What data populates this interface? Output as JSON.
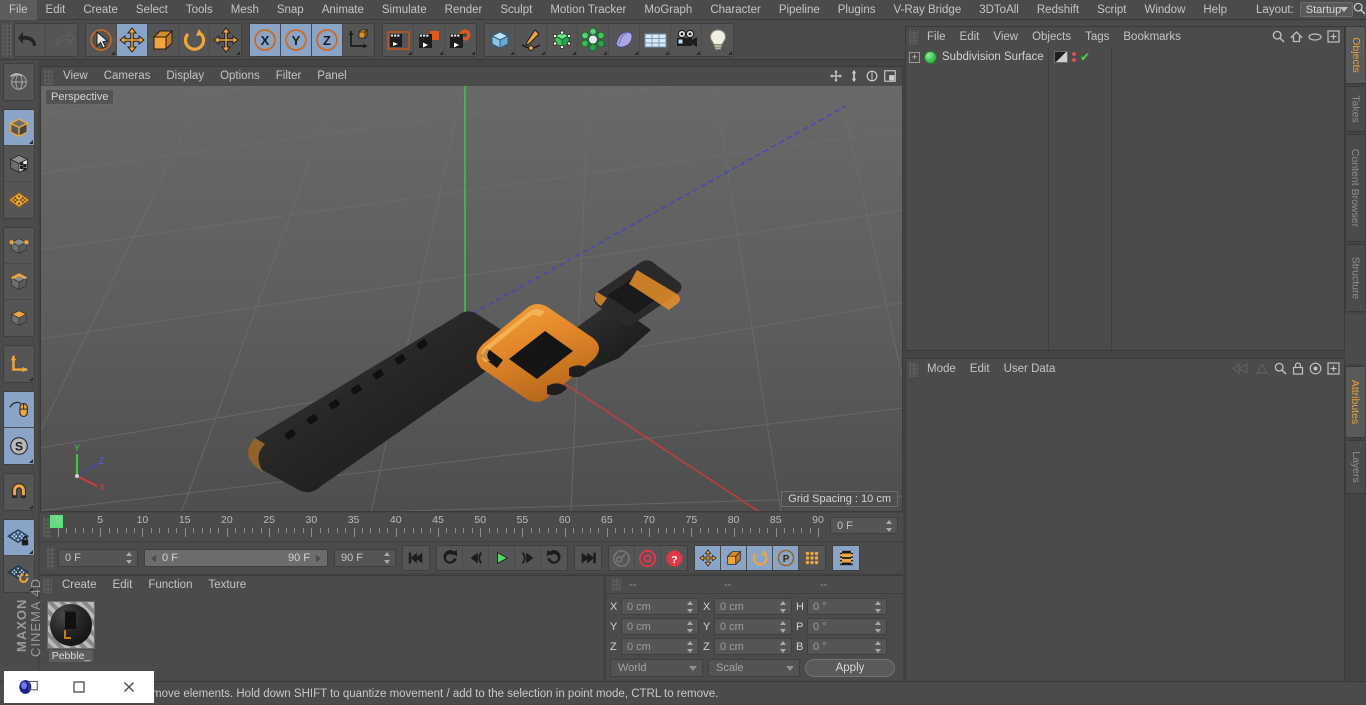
{
  "menubar": {
    "items": [
      "File",
      "Edit",
      "Create",
      "Select",
      "Tools",
      "Mesh",
      "Snap",
      "Animate",
      "Simulate",
      "Render",
      "Sculpt",
      "Motion Tracker",
      "MoGraph",
      "Character",
      "Pipeline",
      "Plugins",
      "V-Ray Bridge",
      "3DToAll",
      "Redshift",
      "Script",
      "Window",
      "Help"
    ],
    "layout_label": "Layout:",
    "layout_value": "Startup",
    "search_icon": "search-icon"
  },
  "toolbar": {
    "groups": [
      {
        "name": "history",
        "buttons": [
          {
            "icon": "undo-icon",
            "label": "Undo",
            "state": "off"
          },
          {
            "icon": "redo-icon",
            "label": "Redo",
            "state": "disabled"
          }
        ]
      },
      {
        "name": "transform",
        "buttons": [
          {
            "icon": "live-selection-icon",
            "label": "Live Selection",
            "state": "off"
          },
          {
            "icon": "move-icon",
            "label": "Move",
            "state": "on"
          },
          {
            "icon": "scale-icon",
            "label": "Scale",
            "state": "off"
          },
          {
            "icon": "rotate-icon",
            "label": "Rotate",
            "state": "off"
          },
          {
            "icon": "move-dup-icon",
            "label": "Move Tool",
            "state": "off"
          }
        ]
      },
      {
        "name": "axis-lock",
        "buttons": [
          {
            "icon": "axis-x-icon",
            "label": "X",
            "state": "on"
          },
          {
            "icon": "axis-y-icon",
            "label": "Y",
            "state": "on"
          },
          {
            "icon": "axis-z-icon",
            "label": "Z",
            "state": "on"
          },
          {
            "icon": "world-object-axis-icon",
            "label": "World/Object",
            "state": "off"
          }
        ]
      },
      {
        "name": "render",
        "buttons": [
          {
            "icon": "render-view-icon",
            "label": "Render View",
            "state": "off"
          },
          {
            "icon": "render-region-icon",
            "label": "Render to Picture Viewer",
            "state": "off"
          },
          {
            "icon": "render-settings-icon",
            "label": "Edit Render Settings",
            "state": "off"
          }
        ]
      },
      {
        "name": "create",
        "buttons": [
          {
            "icon": "cube-primitive-icon",
            "label": "Add Cube Object",
            "state": "off"
          },
          {
            "icon": "spline-pen-icon",
            "label": "Add Spline",
            "state": "off"
          },
          {
            "icon": "generator-icon",
            "label": "Add Generator",
            "state": "off"
          },
          {
            "icon": "deformer-icon",
            "label": "Add Deformer",
            "state": "off"
          },
          {
            "icon": "scene-object-icon",
            "label": "Scene Object",
            "state": "off"
          },
          {
            "icon": "environment-icon",
            "label": "Environment",
            "state": "off"
          },
          {
            "icon": "camera-icon",
            "label": "Add Camera",
            "state": "off"
          },
          {
            "icon": "light-icon",
            "label": "Add Light",
            "state": "off"
          }
        ]
      }
    ]
  },
  "left_palette": {
    "groups": [
      {
        "buttons": [
          {
            "icon": "undo-view-icon",
            "label": "Undo View",
            "state": "off"
          }
        ]
      },
      {
        "buttons": [
          {
            "icon": "model-mode-icon",
            "label": "Model Mode",
            "state": "on"
          },
          {
            "icon": "texture-mode-icon",
            "label": "Texture Mode",
            "state": "off"
          },
          {
            "icon": "workplane-icon",
            "label": "Workplane",
            "state": "off"
          }
        ]
      },
      {
        "buttons": [
          {
            "icon": "points-mode-icon",
            "label": "Points",
            "state": "off"
          },
          {
            "icon": "edges-mode-icon",
            "label": "Edges",
            "state": "off"
          },
          {
            "icon": "polygons-mode-icon",
            "label": "Polygons",
            "state": "off"
          }
        ]
      },
      {
        "buttons": [
          {
            "icon": "axis-modify-icon",
            "label": "Enable Axis Modification",
            "state": "off"
          }
        ]
      },
      {
        "buttons": [
          {
            "icon": "viewport-solo-icon",
            "label": "Viewport Solo",
            "state": "on"
          },
          {
            "icon": "soft-selection-icon",
            "label": "Soft Selection",
            "state": "on"
          }
        ]
      },
      {
        "buttons": [
          {
            "icon": "magnet-icon",
            "label": "Magnet",
            "state": "off"
          }
        ]
      },
      {
        "buttons": [
          {
            "icon": "lock-workplane-icon",
            "label": "Lock Workplane",
            "state": "on"
          },
          {
            "icon": "planar-workplane-icon",
            "label": "Planar Workplane",
            "state": "off"
          }
        ]
      }
    ],
    "brand_top": "MAXON",
    "brand_bottom": "CINEMA 4D"
  },
  "viewport": {
    "menu": [
      "View",
      "Cameras",
      "Display",
      "Options",
      "Filter",
      "Panel"
    ],
    "corner_icons": [
      "pan-icon",
      "dolly-icon",
      "orbit-icon",
      "maximize-icon"
    ],
    "label": "Perspective",
    "grid_spacing": "Grid Spacing : 10 cm",
    "axis_gizmo": {
      "x": "X",
      "y": "Y",
      "z": "Z"
    },
    "scene_object": "Pebble smartwatch"
  },
  "timeline": {
    "ticks": [
      0,
      5,
      10,
      15,
      20,
      25,
      30,
      35,
      40,
      45,
      50,
      55,
      60,
      65,
      70,
      75,
      80,
      85,
      90
    ],
    "current_frame_field": "0 F",
    "playhead_frame": 0
  },
  "playbar": {
    "current_frame": "0 F",
    "range_start": "0 F",
    "range_end": "90 F",
    "max_frame": "90 F",
    "buttons": [
      {
        "icon": "go-to-start-icon",
        "label": "Go to Start",
        "state": "off"
      },
      {
        "icon": "previous-key-icon",
        "label": "Go to Previous Key",
        "state": "off"
      },
      {
        "icon": "previous-frame-icon",
        "label": "Go to Previous Frame",
        "state": "off"
      },
      {
        "icon": "play-icon",
        "label": "Play Forwards",
        "state": "off"
      },
      {
        "icon": "next-frame-icon",
        "label": "Go to Next Frame",
        "state": "off"
      },
      {
        "icon": "next-key-icon",
        "label": "Go to Next Key",
        "state": "off"
      },
      {
        "icon": "go-to-end-icon",
        "label": "Go to End",
        "state": "off"
      }
    ],
    "record_buttons": [
      {
        "icon": "autokey-icon",
        "label": "Autokeying",
        "state": "disabled"
      },
      {
        "icon": "record-icon",
        "label": "Record Active Objects",
        "state": "off"
      },
      {
        "icon": "keyframe-select-icon",
        "label": "Keyframe Selection",
        "state": "off"
      }
    ],
    "param_buttons": [
      {
        "icon": "key-position-icon",
        "label": "Position",
        "state": "on"
      },
      {
        "icon": "key-scale-icon",
        "label": "Scale",
        "state": "on"
      },
      {
        "icon": "key-rotation-icon",
        "label": "Rotation",
        "state": "on"
      },
      {
        "icon": "key-pla-icon",
        "label": "Point Level Animation",
        "state": "on"
      },
      {
        "icon": "key-param-icon",
        "label": "Parameter",
        "state": "off"
      }
    ],
    "dope_button": {
      "icon": "timeline-icon",
      "label": "Timeline",
      "state": "on"
    }
  },
  "material_manager": {
    "menu": [
      "Create",
      "Edit",
      "Function",
      "Texture"
    ],
    "materials": [
      {
        "name": "Pebble_"
      }
    ]
  },
  "coordinates": {
    "headers": [
      "--",
      "--",
      "--"
    ],
    "rows": [
      {
        "label1": "X",
        "value1": "0 cm",
        "label2": "X",
        "value2": "0 cm",
        "label3": "H",
        "value3": "0 °"
      },
      {
        "label1": "Y",
        "value1": "0 cm",
        "label2": "Y",
        "value2": "0 cm",
        "label3": "P",
        "value3": "0 °"
      },
      {
        "label1": "Z",
        "value1": "0 cm",
        "label2": "Z",
        "value2": "0 cm",
        "label3": "B",
        "value3": "0 °"
      }
    ],
    "system": "World",
    "mode": "Scale",
    "apply_label": "Apply"
  },
  "object_manager": {
    "menu": [
      "File",
      "Edit",
      "View",
      "Objects",
      "Tags",
      "Bookmarks"
    ],
    "icons": [
      "search-icon",
      "home-icon",
      "ellipse-icon",
      "add-layer-icon"
    ],
    "objects": [
      {
        "name": "Subdivision Surface",
        "icon": "subdivision-surface-icon",
        "expandable": true,
        "tags": [
          "material-tag",
          "visibility-dots",
          "check-icon"
        ]
      }
    ]
  },
  "attributes_manager": {
    "menu": [
      "Mode",
      "Edit",
      "User Data"
    ],
    "icons": [
      "prev-icon",
      "next-icon",
      "search-icon",
      "lock-icon",
      "target-icon",
      "add-icon"
    ]
  },
  "right_tabs": [
    {
      "label": "Objects",
      "active": true
    },
    {
      "label": "Takes",
      "active": false
    },
    {
      "label": "Content Browser",
      "active": false
    },
    {
      "label": "Structure",
      "active": false
    },
    {
      "label": "Attributes",
      "active": true
    },
    {
      "label": "Layers",
      "active": false
    }
  ],
  "statusbar": {
    "message": "move elements. Hold down SHIFT to quantize movement / add to the selection in point mode, CTRL to remove."
  },
  "window_controls": [
    {
      "icon": "c4d-logo-icon",
      "label": "Restore"
    },
    {
      "icon": "maximize-icon",
      "label": "Maximize"
    },
    {
      "icon": "close-icon",
      "label": "Close"
    }
  ],
  "colors": {
    "accent_orange": "#e8912d",
    "panel_bg": "#4b4b4b",
    "viewport_bg": "#5a5a5a",
    "highlight_blue": "#8aa4c8",
    "axis_x": "#d43b3b",
    "axis_y": "#3ec93e",
    "axis_z": "#4040d0"
  }
}
